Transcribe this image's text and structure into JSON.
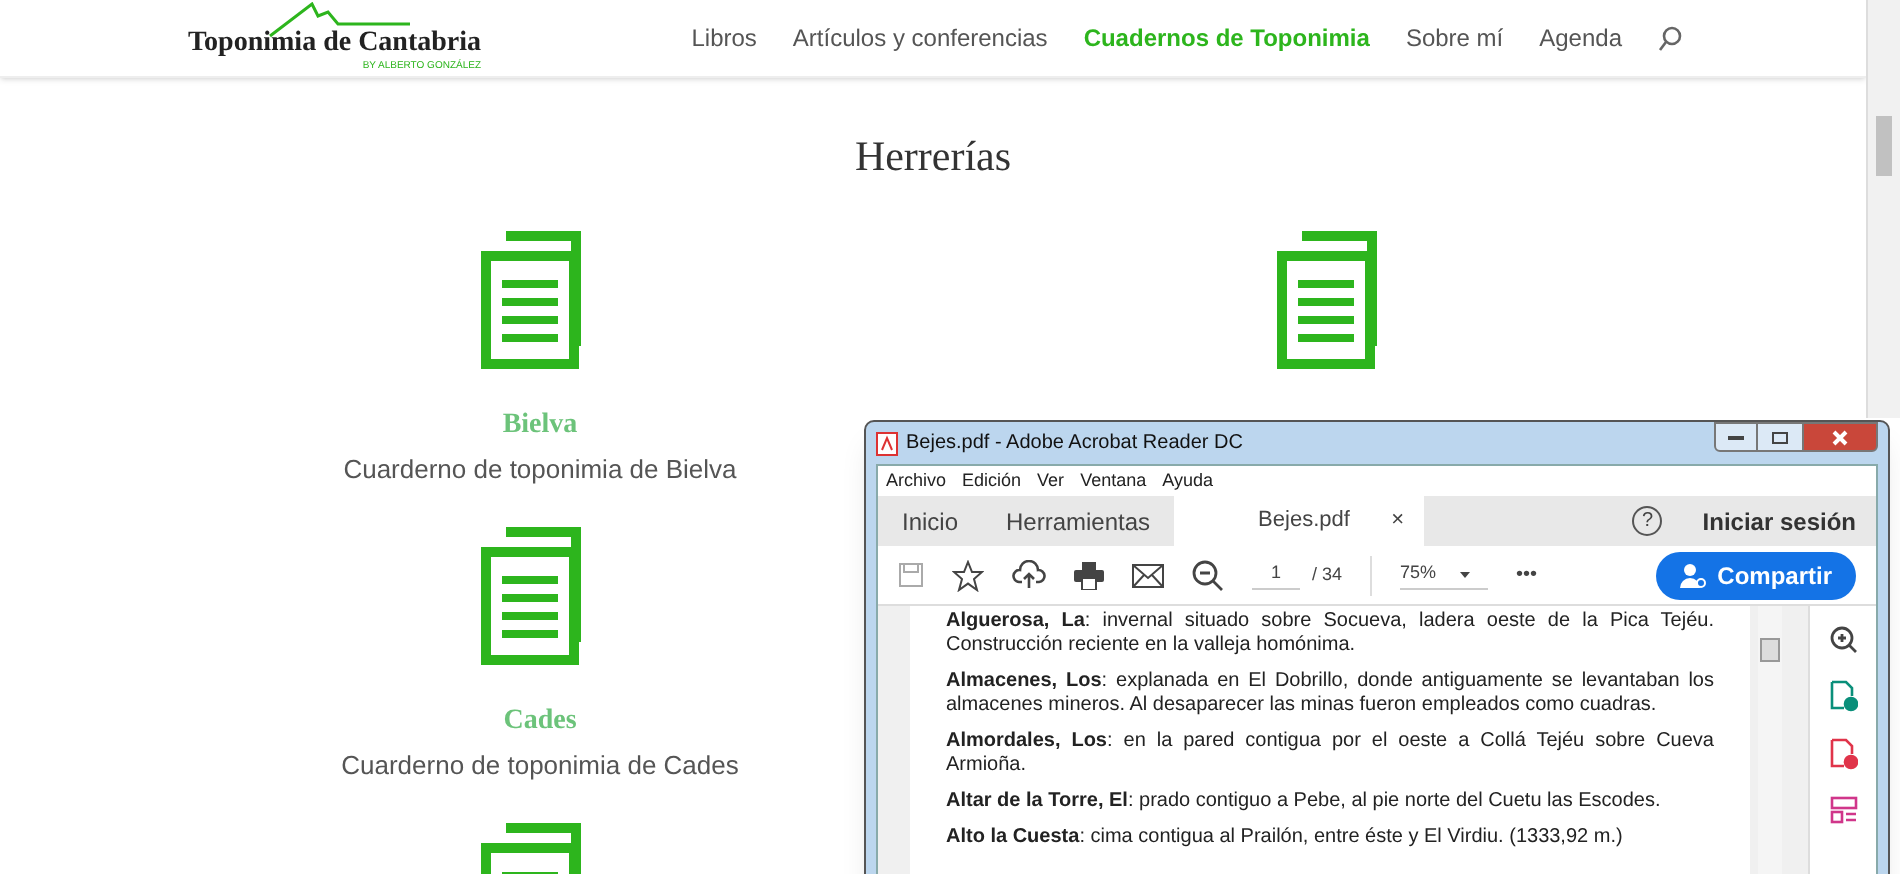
{
  "header": {
    "logo": {
      "title": "Toponimia de Cantabria",
      "subtitle": "BY ALBERTO GONZÁLEZ"
    },
    "nav": [
      {
        "label": "Libros",
        "selected": false
      },
      {
        "label": "Artículos y conferencias",
        "selected": false
      },
      {
        "label": "Cuadernos de Toponimia",
        "selected": true
      },
      {
        "label": "Sobre mí",
        "selected": false
      },
      {
        "label": "Agenda",
        "selected": false
      }
    ]
  },
  "page_title": "Herrerías",
  "left_cards": [
    {
      "kind": "notebook",
      "title": "Bielva",
      "subtitle": "Cuarderno de toponimia de Bielva"
    },
    {
      "kind": "notebook",
      "title": "Cades",
      "subtitle": "Cuarderno de toponimia de Cades"
    },
    {
      "kind": "icon_only"
    }
  ],
  "right_cards": [
    {
      "kind": "icon_only"
    }
  ],
  "pdf_window": {
    "title": "Bejes.pdf - Adobe Acrobat Reader DC",
    "menu": [
      "Archivo",
      "Edición",
      "Ver",
      "Ventana",
      "Ayuda"
    ],
    "tabs": [
      {
        "label": "Inicio",
        "selected": false
      },
      {
        "label": "Herramientas",
        "selected": false
      },
      {
        "label": "Bejes.pdf",
        "selected": true,
        "close": "×"
      }
    ],
    "help": "?",
    "sign_in": "Iniciar sesión",
    "page": "1",
    "page_total": "/ 34",
    "zoom": "75%",
    "more": "•••",
    "share": "Compartir",
    "entries": [
      "**Alguerosa, La**: invernal situado sobre Socueva, ladera oeste de la Pica Tejéu. Construcción reciente en la valleja homónima.",
      "**Almacenes, Los**: explanada en El Dobrillo, donde antiguamente se levantaban los almacenes mineros. Al desaparecer las minas fueron empleados como cuadras.",
      "**Almordales, Los**: en la pared contigua por el oeste a Collá Tejéu sobre Cueva Armioña.",
      "**Altar de la Torre, El**: prado contiguo a Pebe, al pie norte del Cuetu las Escodes.",
      "**Alto la Cuesta**: cima contigua al Prailón, entre éste y El Virdiu. (1333,92 m.)"
    ]
  }
}
